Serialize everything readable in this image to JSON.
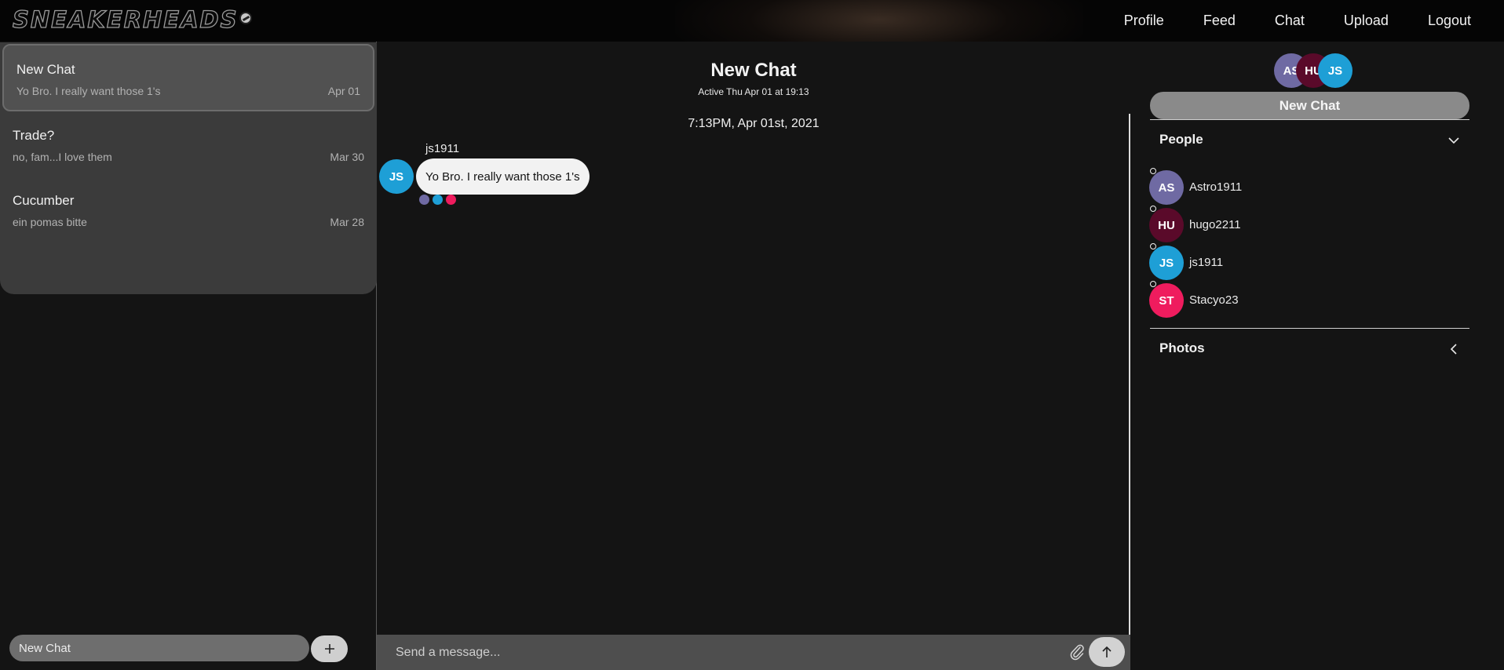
{
  "nav": {
    "logo": "SNEAKERHEADS",
    "links": [
      "Profile",
      "Feed",
      "Chat",
      "Upload",
      "Logout"
    ]
  },
  "chats": [
    {
      "title": "New Chat",
      "preview": "Yo Bro. I really want those 1's",
      "date": "Apr 01"
    },
    {
      "title": "Trade?",
      "preview": "no, fam...I love them",
      "date": "Mar 30"
    },
    {
      "title": "Cucumber",
      "preview": "ein pomas bitte",
      "date": "Mar 28"
    }
  ],
  "new_chat_input": {
    "value": "New Chat"
  },
  "conversation": {
    "title": "New Chat",
    "status": "Active Thu Apr 01 at 19:13",
    "date_divider": "7:13PM, Apr 01st, 2021",
    "message": {
      "sender": "js1911",
      "initials": "JS",
      "text": "Yo Bro. I really want those 1's"
    },
    "read_by_colors": [
      "#6f6aa3",
      "#1e9fd6",
      "#ef1c5e"
    ]
  },
  "composer": {
    "placeholder": "Send a message..."
  },
  "sidebar": {
    "header_avatars": [
      {
        "initials": "AS",
        "color": "#6f6aa3"
      },
      {
        "initials": "HU",
        "color": "#5a0a2a"
      },
      {
        "initials": "JS",
        "color": "#1e9fd6"
      }
    ],
    "new_chat_button": "New Chat",
    "people_title": "People",
    "people": [
      {
        "initials": "AS",
        "name": "Astro1911",
        "color": "#6f6aa3"
      },
      {
        "initials": "HU",
        "name": "hugo2211",
        "color": "#5a0a2a"
      },
      {
        "initials": "JS",
        "name": "js1911",
        "color": "#1e9fd6"
      },
      {
        "initials": "ST",
        "name": "Stacyo23",
        "color": "#ef1c5e"
      }
    ],
    "photos_title": "Photos"
  }
}
